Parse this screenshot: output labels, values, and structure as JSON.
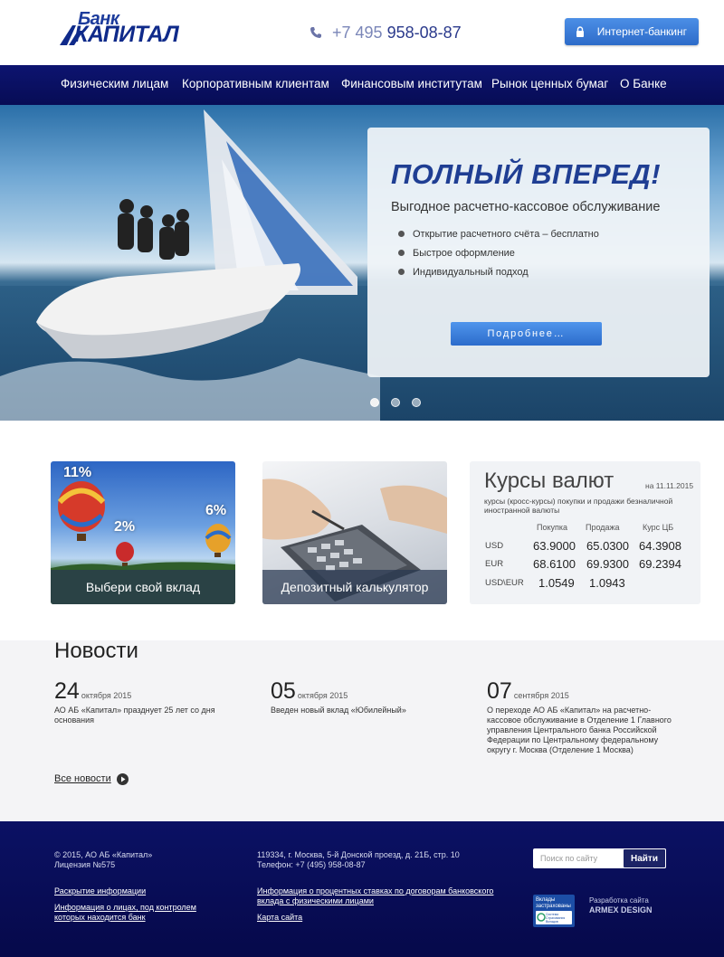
{
  "header": {
    "logo_top": "Банк",
    "logo_main": "КАПИТАЛ",
    "phone_prefix": "+7 495",
    "phone_number": "958-08-87",
    "internet_banking_label": "Интернет-банкинг"
  },
  "nav": {
    "items": [
      {
        "label": "Физическим лицам"
      },
      {
        "label": "Корпоративным клиентам"
      },
      {
        "label": "Финансовым институтам"
      },
      {
        "label": "Рынок ценных бумаг"
      },
      {
        "label": "О Банке"
      }
    ]
  },
  "hero": {
    "title": "ПОЛНЫЙ ВПЕРЕД!",
    "subtitle": "Выгодное расчетно-кассовое обслуживание",
    "bullets": [
      "Открытие расчетного счёта – бесплатно",
      "Быстрое оформление",
      "Индивидуальный подход"
    ],
    "button_label": "Подробнее…",
    "slides_total": 3,
    "slide_active": 1
  },
  "tiles": [
    {
      "caption": "Выбери свой вклад",
      "labels": [
        "11%",
        "2%",
        "6%"
      ]
    },
    {
      "caption": "Депозитный калькулятор"
    }
  ],
  "rates": {
    "title": "Курсы валют",
    "date": "на 11.11.2015",
    "description": "курсы (кросс-курсы) покупки и продажи безналичной иностранной валюты",
    "columns": [
      "Покупка",
      "Продажа",
      "Курс ЦБ"
    ],
    "rows": [
      {
        "currency": "USD",
        "buy": "63.9000",
        "sell": "65.0300",
        "cb": "64.3908"
      },
      {
        "currency": "EUR",
        "buy": "68.6100",
        "sell": "69.9300",
        "cb": "69.2394"
      },
      {
        "currency": "USD\\EUR",
        "buy": "1.0549",
        "sell": "1.0943",
        "cb": ""
      }
    ]
  },
  "news": {
    "heading": "Новости",
    "items": [
      {
        "day": "24",
        "month": "октября 2015",
        "text": "АО АБ «Капитал» празднует 25 лет со дня основания"
      },
      {
        "day": "05",
        "month": "октября 2015",
        "text": "Введен новый вклад «Юбилейный»"
      },
      {
        "day": "07",
        "month": "сентября 2015",
        "text": "О переходе АО АБ «Капитал» на расчетно-кассовое обслуживание в Отделение 1 Главного управления Центрального банка Российской Федерации по Центральному федеральному округу г. Москва (Отделение 1 Москва)"
      }
    ],
    "all_news_label": "Все новости"
  },
  "footer": {
    "copyright": "© 2015, АО АБ «Капитал»",
    "license": "Лицензия №575",
    "disclosure_link": "Раскрытие информации",
    "control_link": "Информация о лицах, под контролем которых находится банк",
    "address": "119334, г. Москва, 5-й Донской проезд, д. 21Б, стр. 10",
    "phone": "Телефон: +7 (495) 958-08-87",
    "rates_link": "Информация о процентных ставках по договорам банковского вклада с физическими лицами",
    "sitemap_link": "Карта сайта",
    "search_placeholder": "Поиск по сайту",
    "search_button": "Найти",
    "badge_line1": "Вклады",
    "badge_line2": "застрахованы",
    "badge_small": "Система Страхования Вкладов",
    "developer_label": "Разработка сайта",
    "developer_name": "ARMEX DESIGN"
  }
}
